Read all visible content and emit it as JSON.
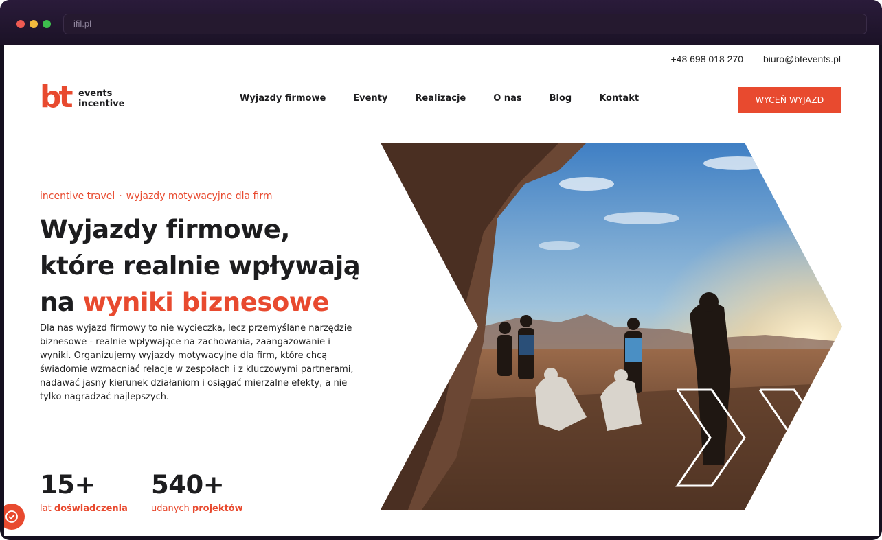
{
  "browser": {
    "url": "ifil.pl"
  },
  "contact": {
    "phone": "+48 698 018 270",
    "email": "biuro@btevents.pl"
  },
  "logo": {
    "mark": "bt",
    "line1": "events",
    "line2": "incentive"
  },
  "nav": {
    "items": [
      "Wyjazdy firmowe",
      "Eventy",
      "Realizacje",
      "O nas",
      "Blog",
      "Kontakt"
    ]
  },
  "cta": {
    "label": "WYCEŃ WYJAZD"
  },
  "hero": {
    "eyebrow_1": "incentive travel",
    "eyebrow_sep": "·",
    "eyebrow_2": "wyjazdy motywacyjne dla firm",
    "title_line1": "Wyjazdy firmowe,",
    "title_line2": "które realnie wpływają",
    "title_line3_prefix": "na ",
    "title_line3_accent": "wyniki biznesowe",
    "lead": "Dla nas wyjazd firmowy to nie wycieczka, lecz przemyślane narzędzie biznesowe - realnie wpływające na zachowania, zaangażowanie i wyniki. Organizujemy wyjazdy motywacyjne dla firm, które chcą świadomie wzmacniać relacje w zespołach i z kluczowymi partnerami, nadawać jasny kierunek działaniom i osiągać mierzalne efekty, a nie tylko nagradzać najlepszych."
  },
  "stats": [
    {
      "value": "15+",
      "label_plain": "lat ",
      "label_bold": "doświadczenia"
    },
    {
      "value": "540+",
      "label_plain": "udanych ",
      "label_bold": "projektów"
    }
  ],
  "icons": {
    "cookie": "cookie-settings-icon",
    "chevrons": "double-chevron-right-icon"
  },
  "colors": {
    "accent": "#e84a2f",
    "text": "#1d1d1f",
    "frame": "#1b1226"
  }
}
